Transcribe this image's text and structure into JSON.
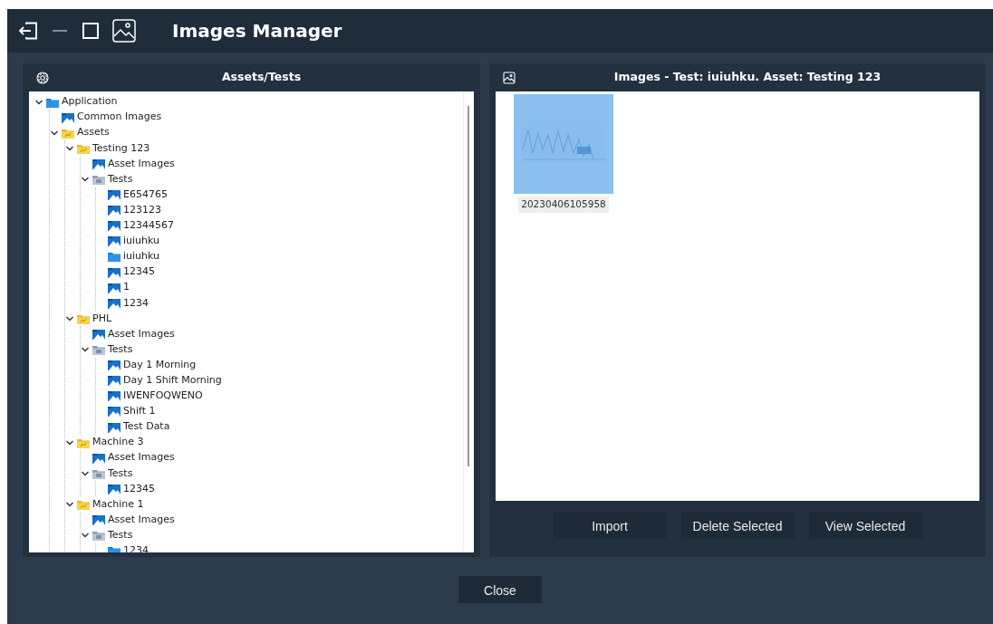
{
  "window": {
    "title": "Images Manager"
  },
  "tree_panel": {
    "title": "Assets/Tests",
    "items": [
      {
        "label": "Application",
        "kind": "root",
        "expanded": true,
        "children": [
          {
            "label": "Common Images",
            "kind": "images"
          },
          {
            "label": "Assets",
            "kind": "asset",
            "expanded": true,
            "children": [
              {
                "label": "Testing 123",
                "kind": "asset",
                "expanded": true,
                "children": [
                  {
                    "label": "Asset Images",
                    "kind": "images"
                  },
                  {
                    "label": "Tests",
                    "kind": "tests",
                    "expanded": true,
                    "children": [
                      {
                        "label": "E654765",
                        "kind": "images"
                      },
                      {
                        "label": "123123",
                        "kind": "images"
                      },
                      {
                        "label": "12344567",
                        "kind": "images"
                      },
                      {
                        "label": "iuiuhku",
                        "kind": "images"
                      },
                      {
                        "label": "iuiuhku",
                        "kind": "folder"
                      },
                      {
                        "label": "12345",
                        "kind": "images"
                      },
                      {
                        "label": "1",
                        "kind": "images"
                      },
                      {
                        "label": "1234",
                        "kind": "images"
                      }
                    ]
                  }
                ]
              },
              {
                "label": "PHL",
                "kind": "asset",
                "expanded": true,
                "children": [
                  {
                    "label": "Asset Images",
                    "kind": "images"
                  },
                  {
                    "label": "Tests",
                    "kind": "tests",
                    "expanded": true,
                    "children": [
                      {
                        "label": "Day 1 Morning",
                        "kind": "images"
                      },
                      {
                        "label": "Day 1 Shift Morning",
                        "kind": "images"
                      },
                      {
                        "label": "IWENFOQWENO",
                        "kind": "images"
                      },
                      {
                        "label": "Shift 1",
                        "kind": "images"
                      },
                      {
                        "label": "Test Data",
                        "kind": "images"
                      }
                    ]
                  }
                ]
              },
              {
                "label": "Machine 3",
                "kind": "asset",
                "expanded": true,
                "children": [
                  {
                    "label": "Asset Images",
                    "kind": "images"
                  },
                  {
                    "label": "Tests",
                    "kind": "tests",
                    "expanded": true,
                    "children": [
                      {
                        "label": "12345",
                        "kind": "images"
                      }
                    ]
                  }
                ]
              },
              {
                "label": "Machine 1",
                "kind": "asset",
                "expanded": true,
                "children": [
                  {
                    "label": "Asset Images",
                    "kind": "images"
                  },
                  {
                    "label": "Tests",
                    "kind": "tests",
                    "expanded": true,
                    "children": [
                      {
                        "label": "1234",
                        "kind": "folder"
                      }
                    ]
                  }
                ]
              }
            ]
          }
        ]
      }
    ]
  },
  "images_panel": {
    "title": "Images - Test: iuiuhku. Asset: Testing 123",
    "images": [
      {
        "caption": "20230406105958",
        "selected": true
      }
    ],
    "buttons": [
      "Import",
      "Delete Selected",
      "View Selected"
    ]
  },
  "footer_buttons": [
    "Close"
  ]
}
